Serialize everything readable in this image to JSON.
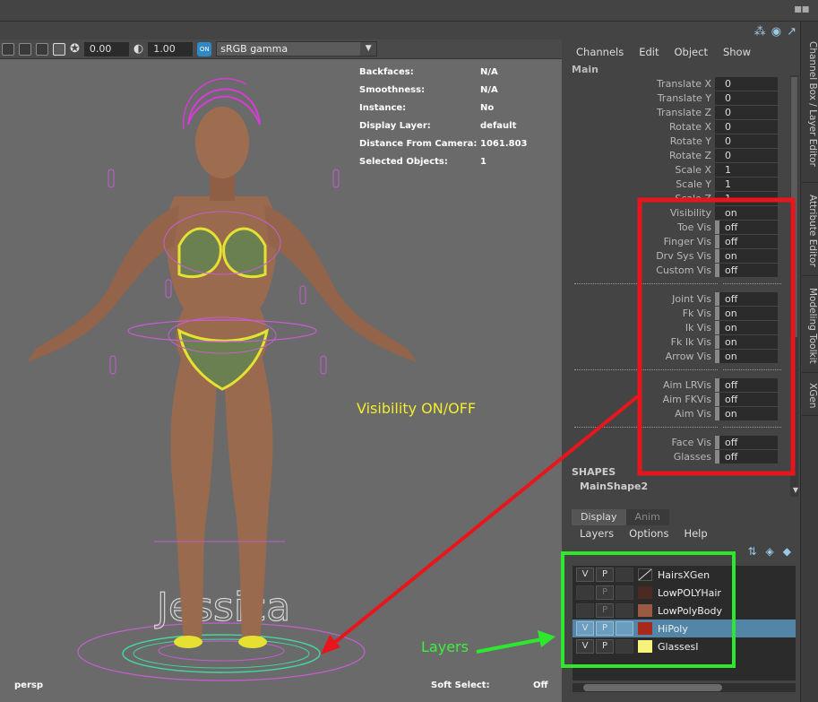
{
  "viewport": {
    "toolbar": {
      "field1": "0.00",
      "field2": "1.00",
      "color_space": "sRGB gamma"
    },
    "hud": [
      {
        "key": "Backfaces:",
        "value": "N/A"
      },
      {
        "key": "Smoothness:",
        "value": "N/A"
      },
      {
        "key": "Instance:",
        "value": "No"
      },
      {
        "key": "Display Layer:",
        "value": "default"
      },
      {
        "key": "Distance From Camera:",
        "value": "1061.803"
      },
      {
        "key": "Selected Objects:",
        "value": "1"
      }
    ],
    "camera": "persp",
    "soft_select_label": "Soft Select:",
    "soft_select_value": "Off",
    "character_name": "Jessica"
  },
  "annotations": {
    "visibility": "Visibility ON/OFF",
    "layers": "Layers",
    "red_color": "#e8161c",
    "green_color": "#2ee82e"
  },
  "channel_box": {
    "menu": [
      "Channels",
      "Edit",
      "Object",
      "Show"
    ],
    "section": "Main",
    "channels": [
      {
        "label": "Translate X",
        "value": "0"
      },
      {
        "label": "Translate Y",
        "value": "0"
      },
      {
        "label": "Translate Z",
        "value": "0"
      },
      {
        "label": "Rotate X",
        "value": "0"
      },
      {
        "label": "Rotate Y",
        "value": "0"
      },
      {
        "label": "Rotate Z",
        "value": "0"
      },
      {
        "label": "Scale X",
        "value": "1"
      },
      {
        "label": "Scale Y",
        "value": "1"
      },
      {
        "label": "Scale Z",
        "value": "1"
      },
      {
        "label": "Visibility",
        "value": "on"
      },
      {
        "label": "Toe Vis",
        "value": "off"
      },
      {
        "label": "Finger Vis",
        "value": "off"
      },
      {
        "label": "Drv Sys Vis",
        "value": "on"
      },
      {
        "label": "Custom Vis",
        "value": "off"
      },
      {
        "label": "",
        "value": ""
      },
      {
        "label": "Joint Vis",
        "value": "off"
      },
      {
        "label": "Fk Vis",
        "value": "on"
      },
      {
        "label": "Ik Vis",
        "value": "on"
      },
      {
        "label": "Fk Ik Vis",
        "value": "on"
      },
      {
        "label": "Arrow Vis",
        "value": "on"
      },
      {
        "label": "",
        "value": ""
      },
      {
        "label": "Aim LRVis",
        "value": "off"
      },
      {
        "label": "Aim FKVis",
        "value": "off"
      },
      {
        "label": "Aim Vis",
        "value": "on"
      },
      {
        "label": "",
        "value": ""
      },
      {
        "label": "Face Vis",
        "value": "off"
      },
      {
        "label": "Glasses",
        "value": "off"
      }
    ],
    "shapes_header": "SHAPES",
    "shape_name": "MainShape2"
  },
  "side_tabs": [
    "Channel Box / Layer Editor",
    "Attribute Editor",
    "Modeling Toolkit",
    "XGen"
  ],
  "layer_editor": {
    "tabs": [
      "Display",
      "Anim"
    ],
    "menu": [
      "Layers",
      "Options",
      "Help"
    ],
    "layers": [
      {
        "v": "V",
        "p": "P",
        "name": "HairsXGen",
        "color": "none",
        "highlight": false
      },
      {
        "v": "",
        "p": "P",
        "name": "LowPOLYHair",
        "color": "#4a2a22",
        "highlight": false
      },
      {
        "v": "",
        "p": "P",
        "name": "LowPolyBody",
        "color": "#9a5a44",
        "highlight": false
      },
      {
        "v": "V",
        "p": "P",
        "name": "HiPoly",
        "color": "#a8281c",
        "highlight": true
      },
      {
        "v": "V",
        "p": "P",
        "name": "GlassesI",
        "color": "#f6f27a",
        "highlight": false
      }
    ]
  }
}
